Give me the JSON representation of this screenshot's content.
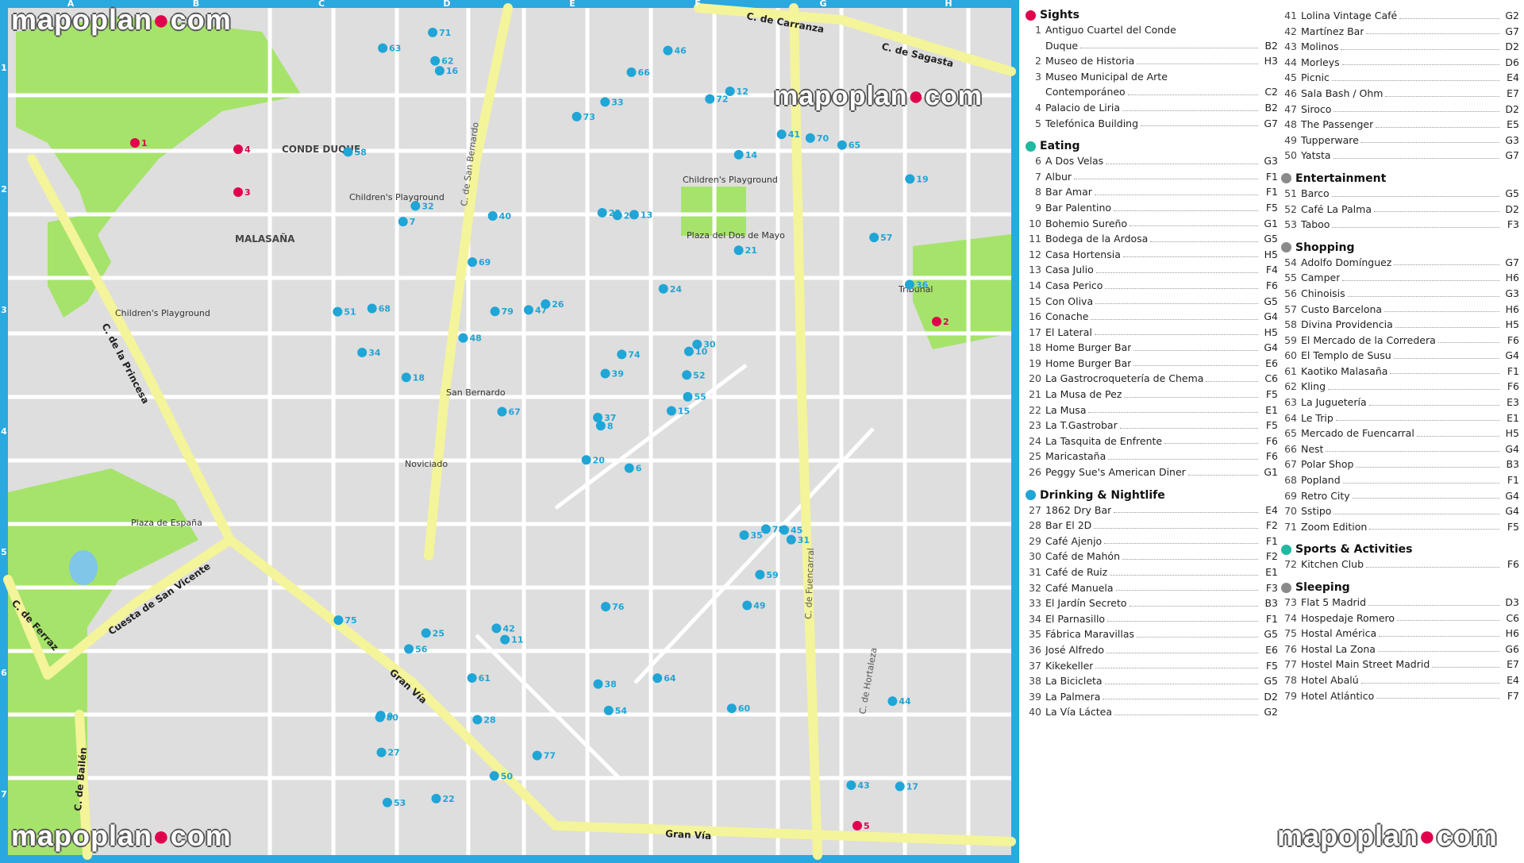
{
  "watermark": {
    "text_a": "mapoplan",
    "dot": "●",
    "text_b": "com"
  },
  "grid": {
    "cols": [
      "A",
      "B",
      "C",
      "D",
      "E",
      "F",
      "G",
      "H"
    ],
    "rows": [
      "1",
      "2",
      "3",
      "4",
      "5",
      "6",
      "7"
    ]
  },
  "colors": {
    "frame": "#2aa8e0",
    "park": "#a6e36b",
    "major_road": "#f4f49a",
    "minor_road": "#ffffff",
    "block": "#dedede",
    "sight_marker": "#e0004d",
    "other_marker": "#1fa5d6"
  },
  "areas": {
    "malasana": "MALASAÑA",
    "conde_duque": "CONDE DUQUE"
  },
  "streets": {
    "carranza": "C. de Carranza",
    "sagasta": "C. de Sagasta",
    "princesa": "C. de la Princesa",
    "cuesta": "Cuesta de San Vicente",
    "gran_via_1": "Gran Vía",
    "gran_via_2": "Gran Vía",
    "ferraz": "C. de Ferraz",
    "bailen": "C. de Bailén",
    "san_bernardo": "C. de San Bernardo",
    "fuencarral": "C. de Fuencarral",
    "hortaleza": "C. de Hortaleza"
  },
  "places": {
    "playground_1": "Children's Playground",
    "playground_2": "Children's Playground",
    "playground_3": "Children's Playground",
    "plaza_dos_mayo": "Plaza del Dos de Mayo",
    "plaza_espana": "Plaza de España",
    "tribunal": "Tribunal",
    "noviciado": "Noviciado",
    "san_bernardo": "San Bernardo"
  },
  "map_markers": [
    {
      "id": "1",
      "type": "sight"
    },
    {
      "id": "2",
      "type": "sight"
    },
    {
      "id": "3",
      "type": "sight"
    },
    {
      "id": "4",
      "type": "sight"
    },
    {
      "id": "5",
      "type": "sight"
    },
    {
      "id": "6",
      "type": "eating"
    },
    {
      "id": "7",
      "type": "eating"
    },
    {
      "id": "8",
      "type": "eating"
    },
    {
      "id": "9",
      "type": "eating"
    },
    {
      "id": "10",
      "type": "eating"
    },
    {
      "id": "11",
      "type": "eating"
    },
    {
      "id": "12",
      "type": "eating"
    },
    {
      "id": "13",
      "type": "eating"
    },
    {
      "id": "14",
      "type": "eating"
    },
    {
      "id": "15",
      "type": "eating"
    },
    {
      "id": "16",
      "type": "eating"
    },
    {
      "id": "17",
      "type": "eating"
    },
    {
      "id": "18",
      "type": "eating"
    },
    {
      "id": "19",
      "type": "eating"
    },
    {
      "id": "20",
      "type": "eating"
    },
    {
      "id": "21",
      "type": "eating"
    },
    {
      "id": "22",
      "type": "eating"
    },
    {
      "id": "23",
      "type": "eating"
    },
    {
      "id": "24",
      "type": "eating"
    },
    {
      "id": "25",
      "type": "eating"
    },
    {
      "id": "26",
      "type": "eating"
    },
    {
      "id": "27",
      "type": "drink"
    },
    {
      "id": "28",
      "type": "drink"
    },
    {
      "id": "29",
      "type": "drink"
    },
    {
      "id": "30",
      "type": "drink"
    },
    {
      "id": "31",
      "type": "drink"
    },
    {
      "id": "32",
      "type": "drink"
    },
    {
      "id": "33",
      "type": "drink"
    },
    {
      "id": "34",
      "type": "drink"
    },
    {
      "id": "35",
      "type": "drink"
    },
    {
      "id": "36",
      "type": "drink"
    },
    {
      "id": "37",
      "type": "drink"
    },
    {
      "id": "38",
      "type": "drink"
    },
    {
      "id": "39",
      "type": "drink"
    },
    {
      "id": "40",
      "type": "drink"
    },
    {
      "id": "41",
      "type": "drink"
    },
    {
      "id": "42",
      "type": "drink"
    },
    {
      "id": "43",
      "type": "drink"
    },
    {
      "id": "44",
      "type": "drink"
    },
    {
      "id": "45",
      "type": "drink"
    },
    {
      "id": "46",
      "type": "drink"
    },
    {
      "id": "47",
      "type": "drink"
    },
    {
      "id": "48",
      "type": "drink"
    },
    {
      "id": "49",
      "type": "drink"
    },
    {
      "id": "50",
      "type": "drink"
    },
    {
      "id": "51",
      "type": "ent"
    },
    {
      "id": "52",
      "type": "ent"
    },
    {
      "id": "53",
      "type": "ent"
    },
    {
      "id": "54",
      "type": "shop"
    },
    {
      "id": "55",
      "type": "shop"
    },
    {
      "id": "56",
      "type": "shop"
    },
    {
      "id": "57",
      "type": "shop"
    },
    {
      "id": "58",
      "type": "shop"
    },
    {
      "id": "59",
      "type": "shop"
    },
    {
      "id": "60",
      "type": "shop"
    },
    {
      "id": "61",
      "type": "shop"
    },
    {
      "id": "62",
      "type": "shop"
    },
    {
      "id": "63",
      "type": "shop"
    },
    {
      "id": "64",
      "type": "shop"
    },
    {
      "id": "65",
      "type": "shop"
    },
    {
      "id": "66",
      "type": "shop"
    },
    {
      "id": "67",
      "type": "shop"
    },
    {
      "id": "68",
      "type": "shop"
    },
    {
      "id": "69",
      "type": "shop"
    },
    {
      "id": "70",
      "type": "shop"
    },
    {
      "id": "71",
      "type": "shop"
    },
    {
      "id": "72",
      "type": "shop"
    },
    {
      "id": "73",
      "type": "sport"
    },
    {
      "id": "74",
      "type": "sleep"
    },
    {
      "id": "75",
      "type": "sleep"
    },
    {
      "id": "76",
      "type": "sleep"
    },
    {
      "id": "77",
      "type": "sleep"
    },
    {
      "id": "78",
      "type": "sleep"
    },
    {
      "id": "79",
      "type": "sleep"
    },
    {
      "id": "80",
      "type": "sleep"
    }
  ],
  "legend": {
    "col1": [
      {
        "title": "Sights",
        "color": "#e0004d",
        "items": [
          {
            "num": "1",
            "name": "Antiguo Cuartel del Conde",
            "grid": ""
          },
          {
            "num": "",
            "name": "Duque",
            "grid": "B2"
          },
          {
            "num": "2",
            "name": "Museo de Historia",
            "grid": "H3"
          },
          {
            "num": "3",
            "name": "Museo Municipal de Arte",
            "grid": ""
          },
          {
            "num": "",
            "name": "Contemporáneo",
            "grid": "C2"
          },
          {
            "num": "4",
            "name": "Palacio de Liria",
            "grid": "B2"
          },
          {
            "num": "5",
            "name": "Telefónica Building",
            "grid": "G7"
          }
        ]
      },
      {
        "title": "Eating",
        "color": "#1fb8a0",
        "items": [
          {
            "num": "6",
            "name": "A Dos Velas",
            "grid": "G3"
          },
          {
            "num": "7",
            "name": "Albur",
            "grid": "F1"
          },
          {
            "num": "8",
            "name": "Bar Amar",
            "grid": "F1"
          },
          {
            "num": "9",
            "name": "Bar Palentino",
            "grid": "F5"
          },
          {
            "num": "10",
            "name": "Bohemio Sureño",
            "grid": "G1"
          },
          {
            "num": "11",
            "name": "Bodega de la Ardosa",
            "grid": "G5"
          },
          {
            "num": "12",
            "name": "Casa Hortensia",
            "grid": "H5"
          },
          {
            "num": "13",
            "name": "Casa Julio",
            "grid": "F4"
          },
          {
            "num": "14",
            "name": "Casa Perico",
            "grid": "F6"
          },
          {
            "num": "15",
            "name": "Con Oliva",
            "grid": "G5"
          },
          {
            "num": "16",
            "name": "Conache",
            "grid": "G4"
          },
          {
            "num": "17",
            "name": "El Lateral",
            "grid": "H5"
          },
          {
            "num": "18",
            "name": "Home Burger Bar",
            "grid": "G4"
          },
          {
            "num": "19",
            "name": "Home Burger Bar",
            "grid": "E6"
          },
          {
            "num": "20",
            "name": "La Gastrocroquetería de Chema",
            "grid": "C6"
          },
          {
            "num": "21",
            "name": "La Musa de Pez",
            "grid": "F5"
          },
          {
            "num": "22",
            "name": "La Musa",
            "grid": "E1"
          },
          {
            "num": "23",
            "name": "La T.Gastrobar",
            "grid": "F5"
          },
          {
            "num": "24",
            "name": "La Tasquita de Enfrente",
            "grid": "F6"
          },
          {
            "num": "25",
            "name": "Maricastaña",
            "grid": "F6"
          },
          {
            "num": "26",
            "name": "Peggy Sue's American Diner",
            "grid": "G1"
          }
        ]
      },
      {
        "title": "Drinking & Nightlife",
        "color": "#1fa5d6",
        "items": [
          {
            "num": "27",
            "name": "1862 Dry Bar",
            "grid": "E4"
          },
          {
            "num": "28",
            "name": "Bar El 2D",
            "grid": "F2"
          },
          {
            "num": "29",
            "name": "Café Ajenjo",
            "grid": "F1"
          },
          {
            "num": "30",
            "name": "Café de Mahón",
            "grid": "F2"
          },
          {
            "num": "31",
            "name": "Café de Ruiz",
            "grid": "E1"
          },
          {
            "num": "32",
            "name": "Café Manuela",
            "grid": "F3"
          },
          {
            "num": "33",
            "name": "El Jardín Secreto",
            "grid": "B3"
          },
          {
            "num": "34",
            "name": "El Parnasillo",
            "grid": "F1"
          },
          {
            "num": "35",
            "name": "Fábrica Maravillas",
            "grid": "G5"
          },
          {
            "num": "36",
            "name": "José Alfredo",
            "grid": "E6"
          },
          {
            "num": "37",
            "name": "Kikekeller",
            "grid": "F5"
          },
          {
            "num": "38",
            "name": "La Bicicleta",
            "grid": "G5"
          },
          {
            "num": "39",
            "name": "La Palmera",
            "grid": "D2"
          },
          {
            "num": "40",
            "name": "La Vía Láctea",
            "grid": "G2"
          }
        ]
      }
    ],
    "col2": [
      {
        "title": "",
        "color": "",
        "items": [
          {
            "num": "41",
            "name": "Lolina Vintage Café",
            "grid": "G2"
          },
          {
            "num": "42",
            "name": "Martínez Bar",
            "grid": "G7"
          },
          {
            "num": "43",
            "name": "Molinos",
            "grid": "D2"
          },
          {
            "num": "44",
            "name": "Morleys",
            "grid": "D6"
          },
          {
            "num": "45",
            "name": "Picnic",
            "grid": "E4"
          },
          {
            "num": "46",
            "name": "Sala Bash / Ohm",
            "grid": "E7"
          },
          {
            "num": "47",
            "name": "Siroco",
            "grid": "D2"
          },
          {
            "num": "48",
            "name": "The Passenger",
            "grid": "E5"
          },
          {
            "num": "49",
            "name": "Tupperware",
            "grid": "G3"
          },
          {
            "num": "50",
            "name": "Yatsta",
            "grid": "G7"
          }
        ]
      },
      {
        "title": "Entertainment",
        "color": "#8a8a8a",
        "items": [
          {
            "num": "51",
            "name": "Barco",
            "grid": "G5"
          },
          {
            "num": "52",
            "name": "Café La Palma",
            "grid": "D2"
          },
          {
            "num": "53",
            "name": "Taboo",
            "grid": "F3"
          }
        ]
      },
      {
        "title": "Shopping",
        "color": "#8a8a8a",
        "items": [
          {
            "num": "54",
            "name": "Adolfo Domínguez",
            "grid": "G7"
          },
          {
            "num": "55",
            "name": "Camper",
            "grid": "H6"
          },
          {
            "num": "56",
            "name": "Chinoisis",
            "grid": "G3"
          },
          {
            "num": "57",
            "name": "Custo Barcelona",
            "grid": "H6"
          },
          {
            "num": "58",
            "name": "Divina Providencia",
            "grid": "H5"
          },
          {
            "num": "59",
            "name": "El Mercado de la Corredera",
            "grid": "F6"
          },
          {
            "num": "60",
            "name": "El Templo de Susu",
            "grid": "G4"
          },
          {
            "num": "61",
            "name": "Kaotiko Malasaña",
            "grid": "F1"
          },
          {
            "num": "62",
            "name": "Kling",
            "grid": "F6"
          },
          {
            "num": "63",
            "name": "La Juguetería",
            "grid": "E3"
          },
          {
            "num": "64",
            "name": "Le Trip",
            "grid": "E1"
          },
          {
            "num": "65",
            "name": "Mercado de Fuencarral",
            "grid": "H5"
          },
          {
            "num": "66",
            "name": "Nest",
            "grid": "G4"
          },
          {
            "num": "67",
            "name": "Polar Shop",
            "grid": "B3"
          },
          {
            "num": "68",
            "name": "Popland",
            "grid": "F1"
          },
          {
            "num": "69",
            "name": "Retro City",
            "grid": "G4"
          },
          {
            "num": "70",
            "name": "Sstipo",
            "grid": "G4"
          },
          {
            "num": "71",
            "name": "Zoom Edition",
            "grid": "F5"
          }
        ]
      },
      {
        "title": "Sports & Activities",
        "color": "#1fb8a0",
        "items": [
          {
            "num": "72",
            "name": "Kitchen Club",
            "grid": "F6"
          }
        ]
      },
      {
        "title": "Sleeping",
        "color": "#8a8a8a",
        "items": [
          {
            "num": "73",
            "name": "Flat 5 Madrid",
            "grid": "D3"
          },
          {
            "num": "74",
            "name": "Hospedaje Romero",
            "grid": "C6"
          },
          {
            "num": "75",
            "name": "Hostal América",
            "grid": "H6"
          },
          {
            "num": "76",
            "name": "Hostal La Zona",
            "grid": "G6"
          },
          {
            "num": "77",
            "name": "Hostel Main Street Madrid",
            "grid": "E7"
          },
          {
            "num": "78",
            "name": "Hotel Abalú",
            "grid": "E4"
          },
          {
            "num": "79",
            "name": "Hotel Atlántico",
            "grid": "F7"
          }
        ]
      }
    ]
  }
}
